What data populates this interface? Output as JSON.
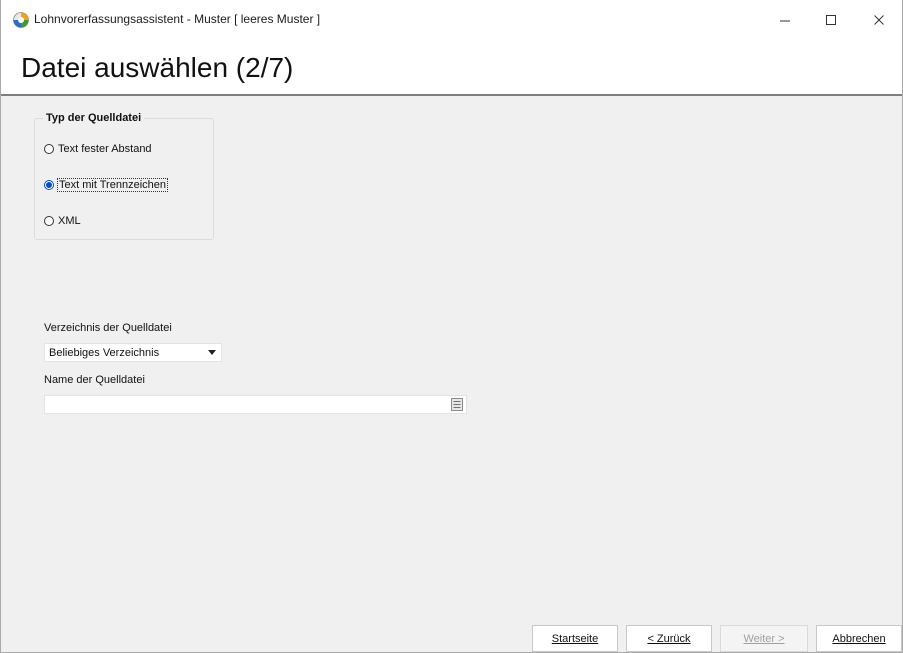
{
  "window": {
    "title": "Lohnvorerfassungsassistent - Muster [ leeres Muster ]",
    "minimize_glyph": "—",
    "maximize_glyph": "☐",
    "close_glyph": "✕"
  },
  "header": {
    "title": "Datei auswählen (2/7)"
  },
  "source_type": {
    "legend": "Typ der Quelldatei",
    "options": [
      {
        "label": "Text fester Abstand",
        "checked": false
      },
      {
        "label": "Text mit Trennzeichen",
        "checked": true
      },
      {
        "label": "XML",
        "checked": false
      }
    ]
  },
  "directory": {
    "label": "Verzeichnis der Quelldatei",
    "selected": "Beliebiges Verzeichnis"
  },
  "filename": {
    "label": "Name der Quelldatei",
    "value": ""
  },
  "buttons": {
    "start": "Startseite",
    "back": "< Zurück",
    "next": "Weiter >",
    "cancel": "Abbrechen"
  },
  "colors": {
    "accent": "#0050c8",
    "header_bg": "#ffffff",
    "body_bg": "#f0f0f0"
  }
}
